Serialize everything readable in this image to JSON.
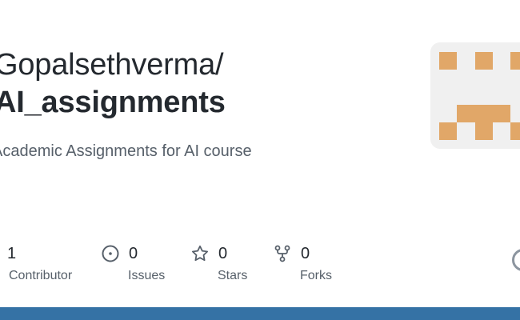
{
  "repo": {
    "owner": "Gopalsethverma/",
    "name": "AI_assignments",
    "description": "Academic Assignments for AI course"
  },
  "stats": [
    {
      "value": "1",
      "label": "Contributor",
      "icon": "people-icon"
    },
    {
      "value": "0",
      "label": "Issues",
      "icon": "issue-icon"
    },
    {
      "value": "0",
      "label": "Stars",
      "icon": "star-icon"
    },
    {
      "value": "0",
      "label": "Forks",
      "icon": "fork-icon"
    }
  ],
  "colors": {
    "language_bar": "#3572a5",
    "identicon": "#e1a768",
    "identicon_bg": "#f0f0f0"
  }
}
